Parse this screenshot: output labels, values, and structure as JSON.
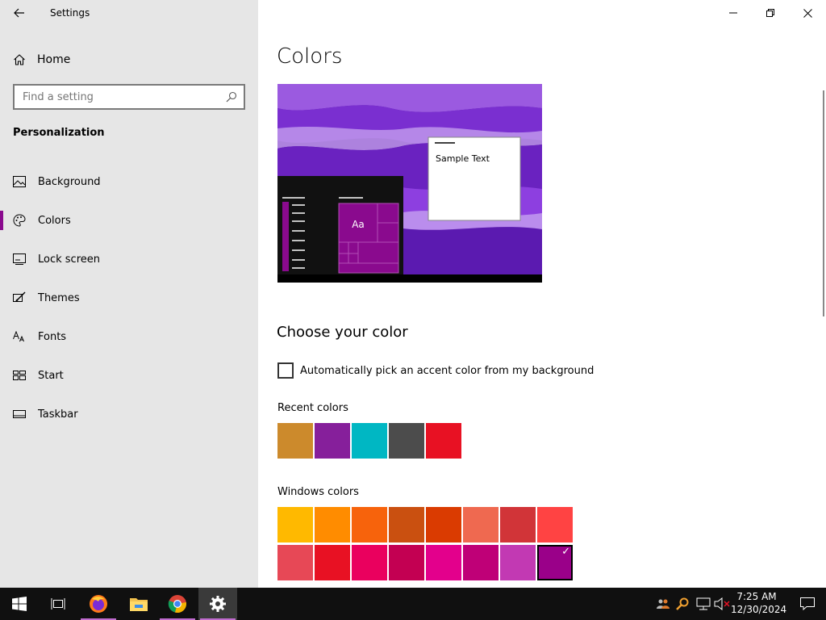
{
  "window": {
    "title": "Settings"
  },
  "sidebar": {
    "home_label": "Home",
    "search_placeholder": "Find a setting",
    "section": "Personalization",
    "items": [
      {
        "label": "Background",
        "icon": "image-icon"
      },
      {
        "label": "Colors",
        "icon": "palette-icon",
        "active": true
      },
      {
        "label": "Lock screen",
        "icon": "lock-screen-icon"
      },
      {
        "label": "Themes",
        "icon": "brush-icon"
      },
      {
        "label": "Fonts",
        "icon": "font-icon"
      },
      {
        "label": "Start",
        "icon": "start-icon"
      },
      {
        "label": "Taskbar",
        "icon": "taskbar-icon"
      }
    ]
  },
  "main": {
    "title": "Colors",
    "preview_sample_text": "Sample Text",
    "preview_tile_label": "Aa",
    "choose_heading": "Choose your color",
    "auto_pick_label": "Automatically pick an accent color from my background",
    "auto_pick_checked": false,
    "recent_label": "Recent colors",
    "recent_colors": [
      "#CC8A2C",
      "#861F9B",
      "#00B7C3",
      "#4C4C4C",
      "#E81123"
    ],
    "windows_label": "Windows colors",
    "windows_colors_row1": [
      "#FFB900",
      "#FF8C00",
      "#F7630C",
      "#CA5010",
      "#DA3B01",
      "#EF6950",
      "#D13438",
      "#FF4343"
    ],
    "windows_colors_row2": [
      "#E74856",
      "#E81123",
      "#EA005E",
      "#C30052",
      "#E3008C",
      "#BF0077",
      "#C239B3",
      "#9A0089"
    ],
    "selected_color": "#9A0089"
  },
  "taskbar": {
    "time": "7:25 AM",
    "date": "12/30/2024",
    "apps": [
      "windows-start-icon",
      "task-view-icon",
      "firefox-icon",
      "file-explorer-icon",
      "chrome-icon",
      "settings-icon"
    ]
  },
  "accent": "#8A0A8E"
}
